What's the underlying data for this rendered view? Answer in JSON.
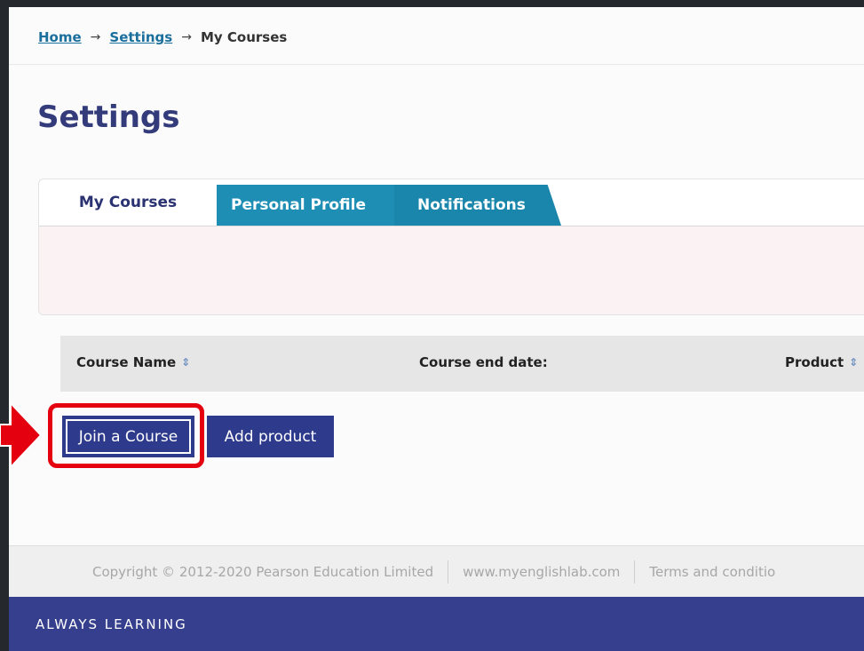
{
  "breadcrumb": {
    "home": "Home",
    "settings": "Settings",
    "current": "My Courses",
    "separator": "→"
  },
  "page": {
    "title": "Settings"
  },
  "tabs": [
    {
      "label": "My Courses",
      "active": true
    },
    {
      "label": "Personal Profile",
      "active": false
    },
    {
      "label": "Notifications",
      "active": false
    }
  ],
  "table": {
    "columns": [
      "Course Name",
      "Course end date:",
      "Product"
    ],
    "sort_icon": "⇕"
  },
  "actions": {
    "join_course": "Join a Course",
    "add_product": "Add product"
  },
  "footer": {
    "copyright": "Copyright © 2012-2020 Pearson Education Limited",
    "site": "www.myenglishlab.com",
    "terms": "Terms and conditio"
  },
  "brand": {
    "tagline": "ALWAYS LEARNING"
  },
  "colors": {
    "accent": "#2e3a8c",
    "tab_inactive": "#1e8eb5",
    "highlight": "#e4000f",
    "title": "#333b7a"
  }
}
